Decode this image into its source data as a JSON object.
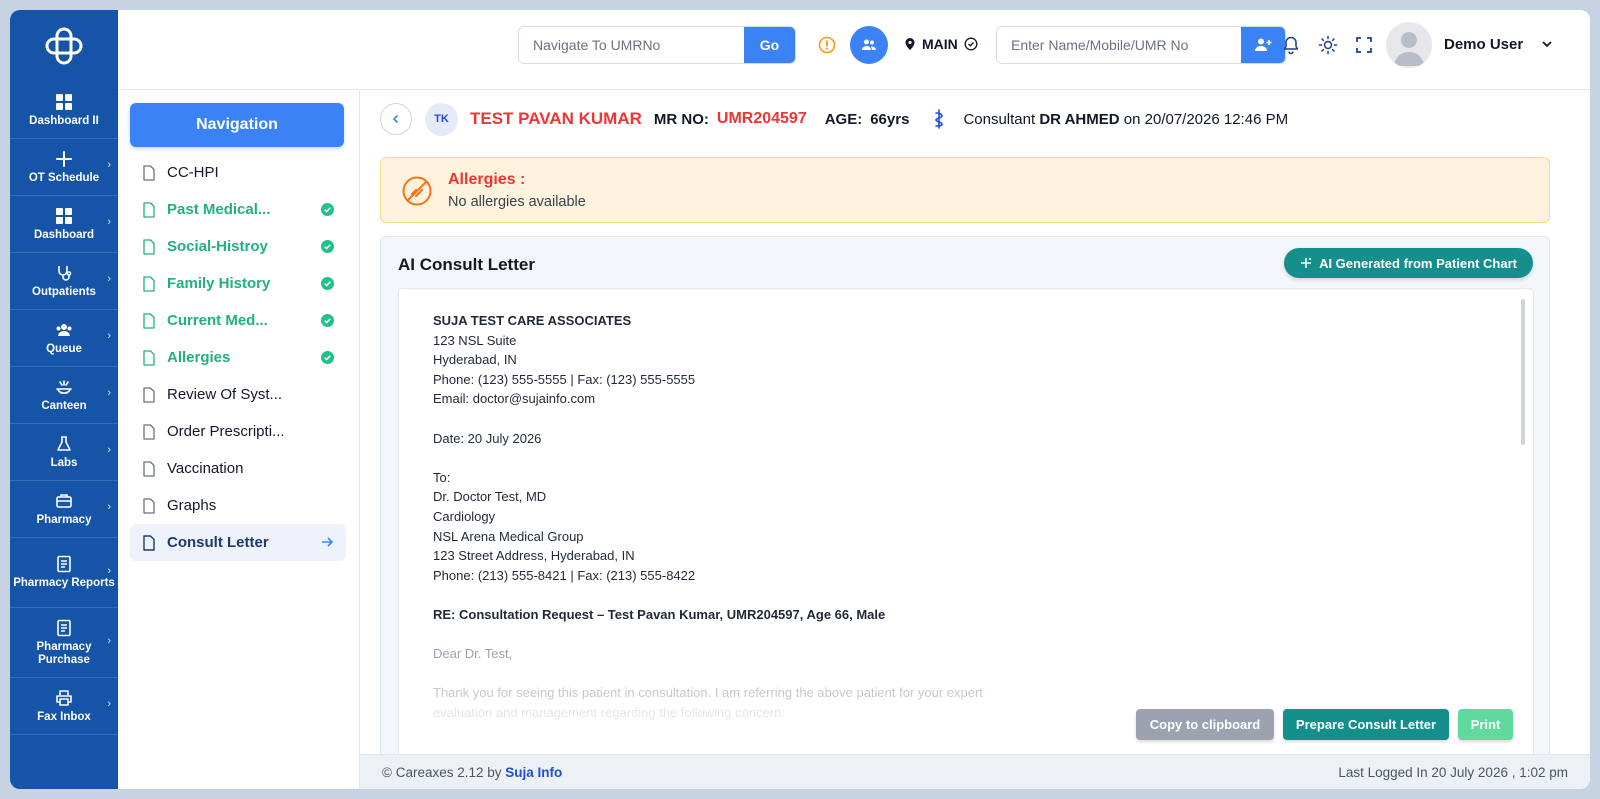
{
  "rail": {
    "items": [
      {
        "label": "Dashboard II",
        "icon": "grid-icon"
      },
      {
        "label": "OT Schedule",
        "icon": "plus-icon"
      },
      {
        "label": "Dashboard",
        "icon": "grid-icon"
      },
      {
        "label": "Outpatients",
        "icon": "stethoscope-icon"
      },
      {
        "label": "Queue",
        "icon": "people-icon"
      },
      {
        "label": "Canteen",
        "icon": "food-icon"
      },
      {
        "label": "Labs",
        "icon": "flask-icon"
      },
      {
        "label": "Pharmacy",
        "icon": "briefcase-icon"
      },
      {
        "label": "Pharmacy Reports",
        "icon": "report-icon"
      },
      {
        "label": "Pharmacy Purchase",
        "icon": "report-icon"
      },
      {
        "label": "Fax Inbox",
        "icon": "printer-icon"
      }
    ]
  },
  "header": {
    "umr_placeholder": "Navigate To UMRNo",
    "go_label": "Go",
    "location": "MAIN",
    "name_placeholder": "Enter Name/Mobile/UMR No",
    "user_name": "Demo User"
  },
  "subnav": {
    "title": "Navigation",
    "items": [
      {
        "label": "CC-HPI",
        "status": "default"
      },
      {
        "label": "Past Medical...",
        "status": "done"
      },
      {
        "label": "Social-Histroy",
        "status": "done"
      },
      {
        "label": "Family History",
        "status": "done"
      },
      {
        "label": "Current Med...",
        "status": "done"
      },
      {
        "label": "Allergies",
        "status": "done"
      },
      {
        "label": "Review Of Syst...",
        "status": "default"
      },
      {
        "label": "Order Prescripti...",
        "status": "default"
      },
      {
        "label": "Vaccination",
        "status": "default"
      },
      {
        "label": "Graphs",
        "status": "default"
      },
      {
        "label": "Consult Letter",
        "status": "active"
      }
    ]
  },
  "patient": {
    "initials": "TK",
    "name": "TEST PAVAN KUMAR",
    "mr_label": "MR NO:",
    "mr_no": "UMR204597",
    "age_label": "AGE:",
    "age": "66yrs",
    "consultant_prefix": "Consultant",
    "consultant_name": "DR AHMED",
    "consultant_suffix": "on 20/07/2026 12:46 PM"
  },
  "allergies": {
    "title": "Allergies :",
    "text": "No allergies available"
  },
  "letter": {
    "card_title": "AI Consult Letter",
    "ai_button": "AI Generated from Patient Chart",
    "org_name": "SUJA TEST CARE ASSOCIATES",
    "org_address1": "123 NSL Suite",
    "org_address2": "Hyderabad, IN",
    "org_phone": "Phone: (123) 555-5555 | Fax: (123) 555-5555",
    "org_email": "Email: doctor@sujainfo.com",
    "date": "Date: 20 July 2026",
    "to_label": "To:",
    "to_name": "Dr. Doctor Test, MD",
    "to_dept": "Cardiology",
    "to_org": "NSL Arena Medical Group",
    "to_address": "123 Street Address, Hyderabad, IN",
    "to_phone": "Phone: (213) 555-8421 | Fax: (213) 555-8422",
    "re_line": "RE: Consultation Request – Test Pavan Kumar, UMR204597, Age 66, Male",
    "salutation": "Dear Dr. Test,",
    "body_line1": "Thank you for seeing this patient in consultation. I am referring the above patient for your expert",
    "body_line2": "evaluation and management regarding the following concern:",
    "copy_button": "Copy to clipboard",
    "prepare_button": "Prepare Consult Letter",
    "print_button": "Print"
  },
  "footer": {
    "copyright": "© Careaxes 2.12 by",
    "brand": "Suja Info",
    "last_logged": "Last Logged In 20 July 2026 , 1:02 pm"
  },
  "colors": {
    "rail_bg": "#1554a6",
    "primary": "#3b82f6",
    "teal": "#148f8c",
    "success": "#22b07d",
    "danger": "#ef3434",
    "warning_bg": "#fdf3dc"
  }
}
